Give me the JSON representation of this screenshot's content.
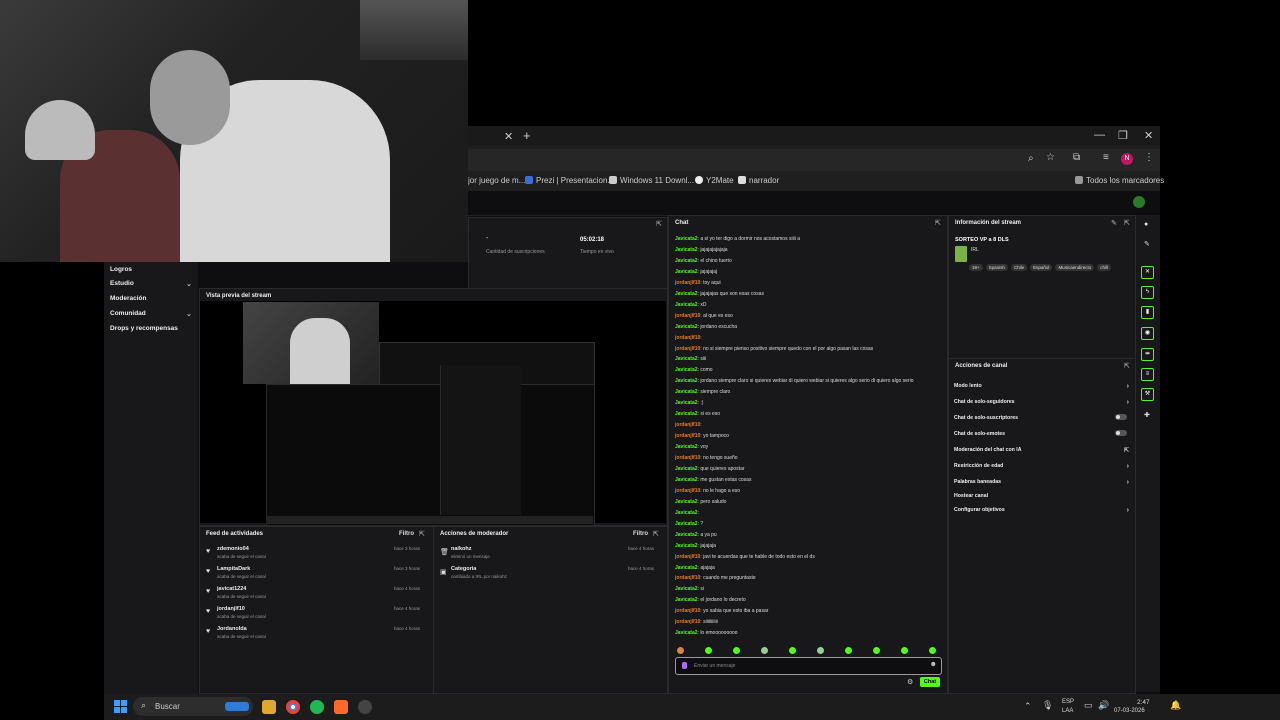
{
  "browser": {
    "bookmarks": [
      {
        "label": "jor juego de m..."
      },
      {
        "label": "Prezi | Presentacion..."
      },
      {
        "label": "Windows 11 Downl..."
      },
      {
        "label": "Y2Mate"
      },
      {
        "label": "narrador"
      },
      {
        "label": "Todos los marcadores"
      }
    ],
    "profile_initial": "N"
  },
  "leftnav": {
    "items": [
      {
        "label": "Logros",
        "chevron": false
      },
      {
        "label": "Estudio",
        "chevron": true
      },
      {
        "label": "Moderación",
        "chevron": false
      },
      {
        "label": "Comunidad",
        "chevron": true
      },
      {
        "label": "Drops y recompensas",
        "chevron": false
      }
    ]
  },
  "stats": {
    "dash": "-",
    "subs_label": "Cantidad de suscripciones",
    "time_value": "05:02:18",
    "time_label": "Tiempo en vivo"
  },
  "preview": {
    "title": "Vista previa del stream"
  },
  "feed": {
    "title": "Feed de actividades",
    "filter": "Filtro",
    "items": [
      {
        "name": "zdemonio04",
        "sub": "acaba de seguir el canal",
        "time": "hace 3 horas"
      },
      {
        "name": "LampitaDark",
        "sub": "acaba de seguir el canal",
        "time": "hace 3 horas"
      },
      {
        "name": "javicat1224",
        "sub": "acaba de seguir el canal",
        "time": "hace 4 horas"
      },
      {
        "name": "jordanjlf10",
        "sub": "acaba de seguir el canal",
        "time": "hace 4 horas"
      },
      {
        "name": "Jordanolda",
        "sub": "acaba de seguir el canal",
        "time": "hace 4 horas"
      }
    ]
  },
  "mod": {
    "title": "Acciones de moderador",
    "filter": "Filtro",
    "items": [
      {
        "name": "naikohz",
        "sub": "eliminó un mensaje",
        "time": "hace 4 horas"
      },
      {
        "name": "Categoria",
        "sub": "cambiado a IRL por naikohz",
        "time": "hace 4 horas"
      }
    ]
  },
  "chat": {
    "title": "Chat",
    "messages": [
      {
        "user": "Javicata2",
        "text": "a si yo ter digo a dormir nos acostamos siiii a",
        "color": "#53fc18"
      },
      {
        "user": "Javicata2",
        "text": "jajajajajajaja",
        "color": "#53fc18"
      },
      {
        "user": "Javicata2",
        "text": "el chino tuerto",
        "color": "#53fc18"
      },
      {
        "user": "Javicata2",
        "text": "jajajajaj",
        "color": "#53fc18"
      },
      {
        "user": "jordanjlf10",
        "text": "toy aqui",
        "color": "#e67e22"
      },
      {
        "user": "Javicata2",
        "text": "jajajajas que son esas cosas",
        "color": "#53fc18"
      },
      {
        "user": "Javicata2",
        "text": "xD",
        "color": "#53fc18"
      },
      {
        "user": "jordanjlf10",
        "text": "al que es eso",
        "color": "#e67e22"
      },
      {
        "user": "Javicata2",
        "text": "jordano escucha",
        "color": "#53fc18"
      },
      {
        "user": "jordanjlf10",
        "text": "",
        "color": "#e67e22"
      },
      {
        "user": "jordanjlf10",
        "text": "no si siempre pienso positivo siempre quedo con el por algo pasan las cosas",
        "color": "#e67e22"
      },
      {
        "user": "Javicata2",
        "text": "siii",
        "color": "#53fc18"
      },
      {
        "user": "Javicata2",
        "text": "como",
        "color": "#53fc18"
      },
      {
        "user": "Javicata2",
        "text": "jordano siempre claro si quieres webiar di quiero webiar si quieres algo serio di quiero algo serio",
        "color": "#53fc18"
      },
      {
        "user": "Javicata2",
        "text": "siempre claro",
        "color": "#53fc18"
      },
      {
        "user": "Javicata2",
        "text": ":)",
        "color": "#53fc18"
      },
      {
        "user": "Javicata2",
        "text": "si es eso",
        "color": "#53fc18"
      },
      {
        "user": "jordanjlf10",
        "text": "",
        "color": "#e67e22"
      },
      {
        "user": "jordanjlf10",
        "text": "yo tampoco",
        "color": "#e67e22"
      },
      {
        "user": "Javicata2",
        "text": "voy",
        "color": "#53fc18"
      },
      {
        "user": "jordanjlf10",
        "text": "no tengo sueño",
        "color": "#e67e22"
      },
      {
        "user": "Javicata2",
        "text": "que quieres apostar",
        "color": "#53fc18"
      },
      {
        "user": "Javicata2",
        "text": "me gustan estas cosas",
        "color": "#53fc18"
      },
      {
        "user": "jordanjlf10",
        "text": "no le hago a eso",
        "color": "#e67e22"
      },
      {
        "user": "Javicata2",
        "text": "pero saludo",
        "color": "#53fc18"
      },
      {
        "user": "Javicata2",
        "text": "",
        "color": "#53fc18"
      },
      {
        "user": "Javicata2",
        "text": "?",
        "color": "#53fc18"
      },
      {
        "user": "Javicata2",
        "text": "a ya pu",
        "color": "#53fc18"
      },
      {
        "user": "Javicata2",
        "text": "jajajaja",
        "color": "#53fc18"
      },
      {
        "user": "jordanjlf10",
        "text": "javi te acuerdas que te hable de todo esto en el ds",
        "color": "#e67e22"
      },
      {
        "user": "Javicata2",
        "text": "ajajaja",
        "color": "#53fc18"
      },
      {
        "user": "jordanjlf10",
        "text": "cuando me preguntaste",
        "color": "#e67e22"
      },
      {
        "user": "Javicata2",
        "text": "si",
        "color": "#53fc18"
      },
      {
        "user": "Javicata2",
        "text": "el jordano lo decreto",
        "color": "#53fc18"
      },
      {
        "user": "jordanjlf10",
        "text": "yo sabia que esto iba a pasar",
        "color": "#e67e22"
      },
      {
        "user": "jordanjlf10",
        "text": "siiiiiiiiiii",
        "color": "#e67e22"
      },
      {
        "user": "Javicata2",
        "text": "lo emooooooooo",
        "color": "#53fc18"
      }
    ],
    "input_placeholder": "Enviar un mensaje",
    "send_label": "Chat"
  },
  "info": {
    "title": "Información del stream",
    "stream_title": "SORTEO VP a 8 DLS",
    "category": "IRL",
    "tags": [
      "18+",
      "Spanish",
      "Chile",
      "Español",
      "Musicaendirecto",
      "chill"
    ]
  },
  "acciones": {
    "title": "Acciones de canal",
    "rows": [
      {
        "label": "Modo lento",
        "type": "chevron"
      },
      {
        "label": "Chat de solo-seguidores",
        "type": "chevron"
      },
      {
        "label": "Chat de solo-suscriptores",
        "type": "toggle"
      },
      {
        "label": "Chat de solo-emotes",
        "type": "toggle"
      },
      {
        "label": "Moderación del chat con IA",
        "type": "external"
      },
      {
        "label": "Restricción de edad",
        "type": "chevron"
      },
      {
        "label": "Palabras baneadas",
        "type": "chevron"
      },
      {
        "label": "Hostear canal",
        "type": "none"
      },
      {
        "label": "Configurar objetivos",
        "type": "chevron"
      }
    ]
  },
  "taskbar": {
    "search": "Buscar",
    "lang1": "ESP",
    "lang2": "LAA",
    "time": "2:47",
    "date": "07-03-2026"
  }
}
